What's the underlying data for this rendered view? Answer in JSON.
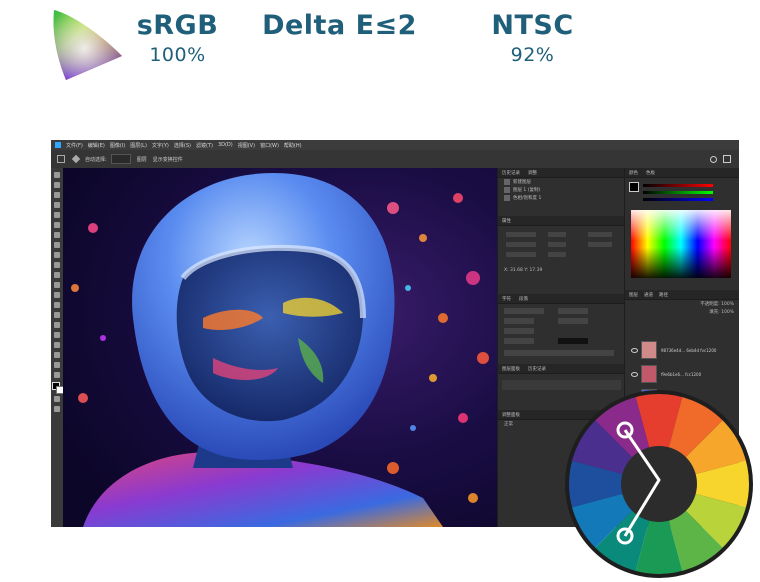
{
  "specs": [
    {
      "title": "sRGB",
      "value": "100%"
    },
    {
      "title": "Delta E≤2",
      "value": ""
    },
    {
      "title": "NTSC",
      "value": "92%"
    }
  ],
  "colors": {
    "spec_text": "#1f5f7a",
    "app_bg": "#2b2b2b",
    "panel_bg": "#2f2f2f"
  },
  "editor": {
    "menu": [
      "文件(F)",
      "编辑(E)",
      "图像(I)",
      "图层(L)",
      "文字(Y)",
      "选择(S)",
      "滤镜(T)",
      "3D(D)",
      "视图(V)",
      "窗口(W)",
      "帮助(H)"
    ],
    "options": [
      "自动选择:",
      "图层",
      "显示变换控件"
    ],
    "mid_panel": {
      "tabs": [
        "历史记录",
        "调整"
      ],
      "rows": [
        "新建图层",
        "图层 1 (复制)",
        "色相/饱和度 1"
      ],
      "props_tab": "属性",
      "coords": "X: 31.68 Y: 17.39",
      "char_tab": "字符",
      "char_tab2": "段落",
      "tab_bottom1": "图层面板",
      "tab_bottom2": "历史记录",
      "tab_bottom3": "调整面板",
      "mode_label": "正常",
      "footer": "无"
    },
    "right_panel": {
      "tabs": [
        "颜色",
        "色板"
      ],
      "layers_tabs": [
        "图层",
        "通道",
        "路径"
      ],
      "opacity_label": "不透明度: 100%",
      "fill_label": "填充: 100%",
      "layers": [
        "98736e4d... 6eb4d fvc1200",
        "f9e6b1e6... fcc1200",
        "图层 1780"
      ]
    }
  },
  "wheel": {
    "segments": [
      "#e53e2e",
      "#f06a2a",
      "#f6a62b",
      "#f7d52c",
      "#b9d33a",
      "#5db548",
      "#1a9a54",
      "#0a8a7a",
      "#1479b8",
      "#1d4f9e",
      "#4a2f8f",
      "#8a2a8a"
    ]
  }
}
